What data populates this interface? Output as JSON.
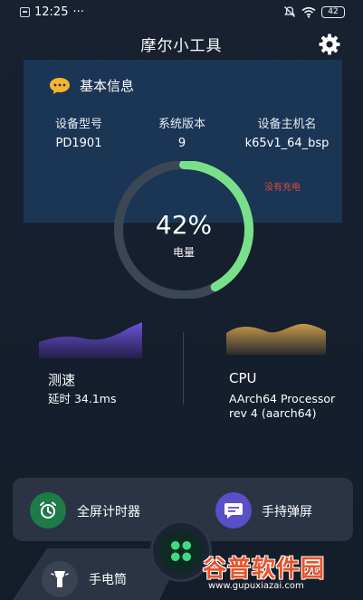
{
  "status_bar": {
    "time": "12:25",
    "more": "···",
    "battery": "42"
  },
  "app": {
    "title": "摩尔小工具"
  },
  "basic_info": {
    "title": "基本信息",
    "fields": [
      {
        "label": "设备型号",
        "value": "PD1901"
      },
      {
        "label": "系统版本",
        "value": "9"
      },
      {
        "label": "设备主机名",
        "value": "k65v1_64_bsp"
      }
    ],
    "charging_status": "没有充电"
  },
  "battery_gauge": {
    "percent_text": "42%",
    "level_fraction": 0.42,
    "label": "电量"
  },
  "speed_test": {
    "title": "测速",
    "latency": "延时 34.1ms"
  },
  "cpu": {
    "title": "CPU",
    "description_line1": "AArch64 Processor",
    "description_line2": "rev 4 (aarch64)"
  },
  "tools": {
    "timer": "全屏计时器",
    "handheld_barrage": "手持弹屏",
    "flashlight": "手电筒"
  },
  "watermark": {
    "name": "谷普软件园",
    "url": "www.gupuxiazai.com"
  },
  "colors": {
    "card_bg": "#1b3555",
    "gauge_fill": "#79e08a",
    "gauge_track": "#3c4756",
    "charging_text": "#e2483f",
    "timer_icon": "#1e7a48",
    "barrage_icon": "#5a4fc8",
    "brand_watermark": "#e8542a"
  }
}
